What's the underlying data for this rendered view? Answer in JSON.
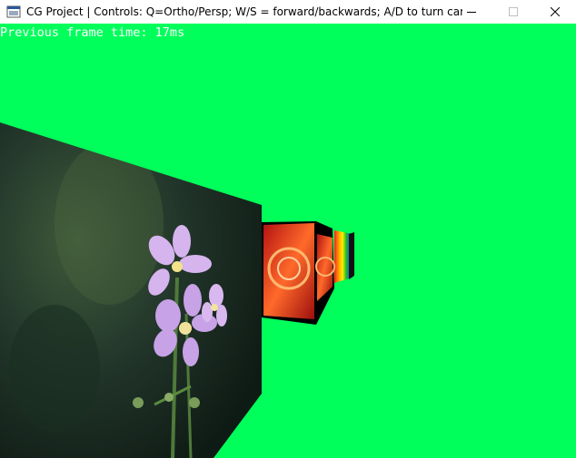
{
  "window": {
    "title": "CG Project | Controls: Q=Ortho/Persp; W/S = forward/backwards; A/D to turn camera; ...",
    "icon": "opengl-app-icon",
    "controls": {
      "minimize_icon": "minimize-icon",
      "maximize_icon": "maximize-icon",
      "close_icon": "close-icon"
    }
  },
  "viewport": {
    "background_color": "#00ff5a",
    "overlay": {
      "frame_time_text": "Previous frame time: 17ms"
    },
    "scene": {
      "objects": [
        {
          "name": "textured-cube-flower",
          "texture": "flower-photo"
        },
        {
          "name": "textured-cube-mandala",
          "texture": "red-mandala"
        },
        {
          "name": "textured-cube-rainbow",
          "texture": "rainbow-stripes"
        }
      ]
    }
  }
}
